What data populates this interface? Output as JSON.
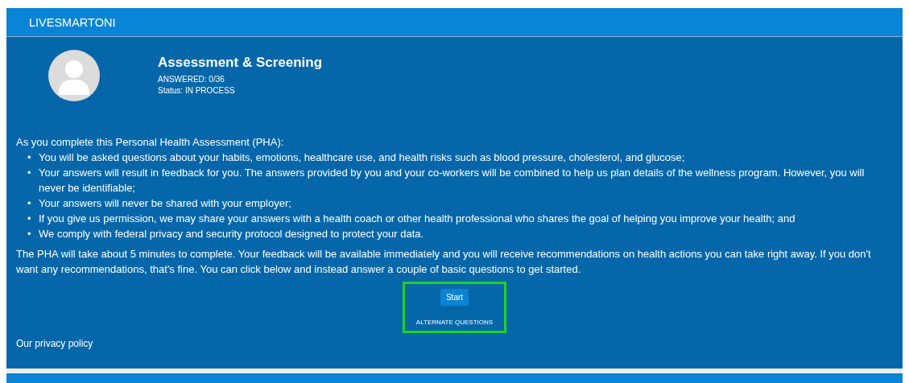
{
  "header": {
    "brand": "LIVESMARTONI"
  },
  "assessment": {
    "title": "Assessment & Screening",
    "answered": "ANSWERED: 0/36",
    "status": "Status: IN PROCESS"
  },
  "intro": "As you complete this Personal Health Assessment (PHA):",
  "bullets": [
    {
      "marker": "•",
      "text": "You will be asked questions about your habits, emotions, healthcare use, and health risks such as blood pressure, cholesterol, and glucose;"
    },
    {
      "marker": "•",
      "text": "Your answers will result in feedback for you. The answers provided by you and your co-workers will be combined to help us plan details of the wellness program. However, you will never be identifiable;"
    },
    {
      "marker": "•",
      "text": "Your answers will never be shared with your employer;"
    },
    {
      "marker": "•",
      "text": "If you give us permission, we may share your answers with a health coach or other health professional who shares the goal of helping you improve your health; and"
    },
    {
      "marker": "•",
      "text": "We comply with federal privacy and security protocol designed to protect your data."
    }
  ],
  "note": "The PHA will take about 5 minutes to complete. Your feedback will be available immediately and you will receive recommendations on health actions you can take right away. If you don't want any recommendations, that's fine. You can click below and instead answer a couple of basic questions to get started.",
  "actions": {
    "highlighted": true,
    "start": "Start",
    "alternate": "ALTERNATE QUESTIONS"
  },
  "privacy_link": "Our privacy policy"
}
